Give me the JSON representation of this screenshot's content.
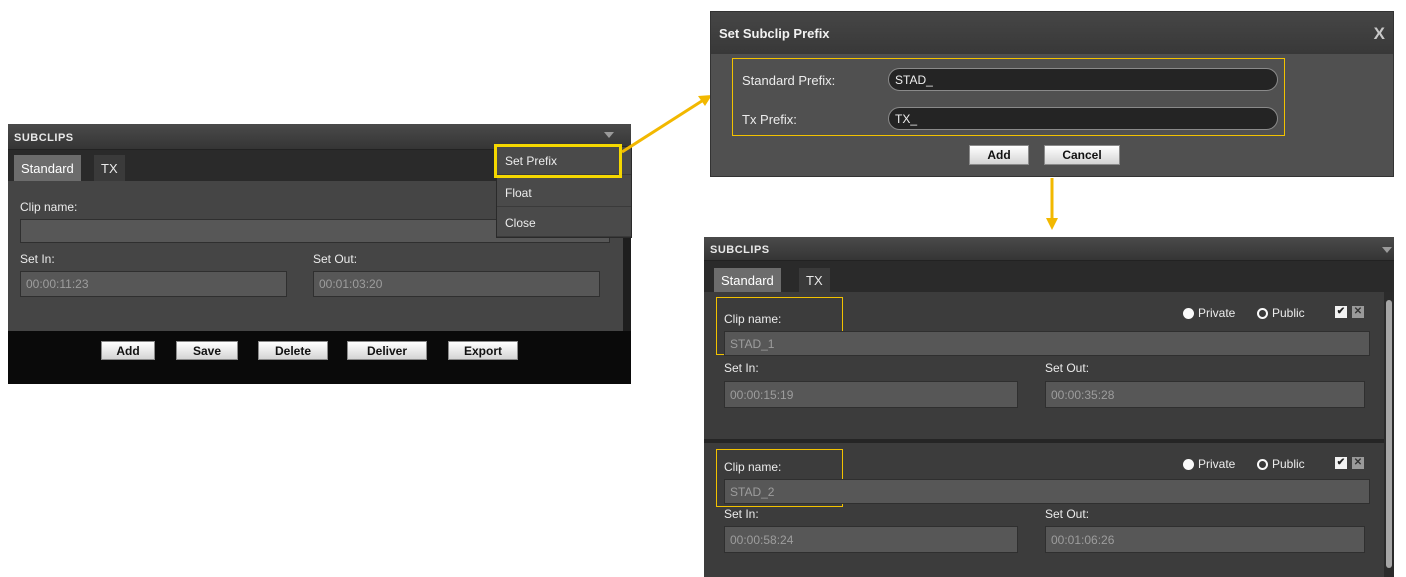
{
  "left_panel": {
    "title": "SUBCLIPS",
    "tabs": [
      {
        "label": "Standard"
      },
      {
        "label": "TX"
      }
    ],
    "clip_name_label": "Clip name:",
    "clip_name_value": "",
    "set_in_label": "Set In:",
    "set_in_value": "00:00:11:23",
    "set_out_label": "Set Out:",
    "set_out_value": "00:01:03:20",
    "buttons": [
      "Add",
      "Save",
      "Delete",
      "Deliver",
      "Export"
    ]
  },
  "context_menu": {
    "items": [
      {
        "label": "Set Prefix"
      },
      {
        "label": "Float"
      },
      {
        "label": "Close"
      }
    ]
  },
  "dialog": {
    "title": "Set Subclip Prefix",
    "close_label": "X",
    "standard_prefix_label": "Standard Prefix:",
    "standard_prefix_value": "STAD_",
    "tx_prefix_label": "Tx Prefix:",
    "tx_prefix_value": "TX_",
    "add_label": "Add",
    "cancel_label": "Cancel"
  },
  "right_panel": {
    "title": "SUBCLIPS",
    "tabs": [
      {
        "label": "Standard"
      },
      {
        "label": "TX"
      }
    ],
    "visibility_options": [
      "Private",
      "Public"
    ],
    "items": [
      {
        "clip_name_label": "Clip name:",
        "clip_name_value": "STAD_1",
        "set_in_label": "Set In:",
        "set_in_value": "00:00:15:19",
        "set_out_label": "Set Out:",
        "set_out_value": "00:00:35:28"
      },
      {
        "clip_name_label": "Clip name:",
        "clip_name_value": "STAD_2",
        "set_in_label": "Set In:",
        "set_in_value": "00:00:58:24",
        "set_out_label": "Set Out:",
        "set_out_value": "00:01:06:26"
      }
    ]
  },
  "colors": {
    "highlight": "#f2c200",
    "panel_bg": "#454545",
    "tab_bar": "#2a2a2a",
    "arrow": "#f2b800"
  }
}
